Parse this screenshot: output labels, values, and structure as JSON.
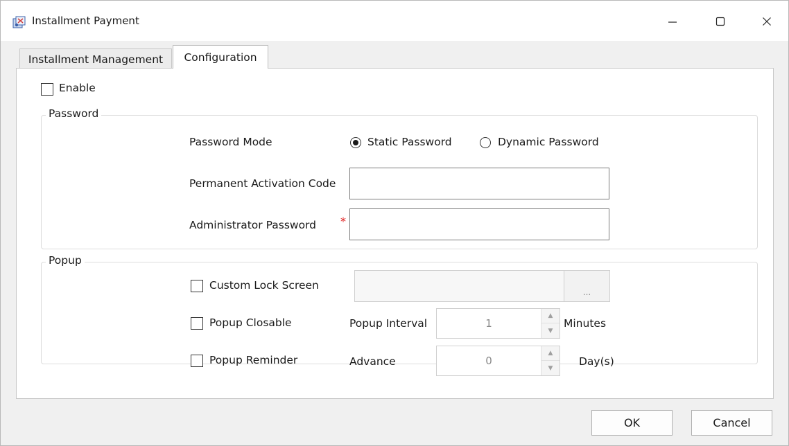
{
  "window": {
    "title": "Installment Payment",
    "icon": "app-icon",
    "controls": [
      "minimize-icon",
      "maximize-icon",
      "close-icon"
    ]
  },
  "tabs": [
    {
      "label": "Installment Management",
      "active": false
    },
    {
      "label": "Configuration",
      "active": true
    }
  ],
  "enable": {
    "label": "Enable",
    "checked": false
  },
  "password": {
    "legend": "Password",
    "mode_label": "Password Mode",
    "modes": [
      {
        "label": "Static Password",
        "selected": true
      },
      {
        "label": "Dynamic Password",
        "selected": false
      }
    ],
    "activation_label": "Permanent Activation Code",
    "activation_value": "",
    "admin_label": "Administrator Password",
    "admin_required_mark": "*",
    "admin_value": ""
  },
  "popup": {
    "legend": "Popup",
    "custom_lock_screen_label": "Custom Lock Screen",
    "custom_lock_screen_checked": false,
    "custom_lock_screen_path": "",
    "browse_label": "...",
    "closable_label": "Popup Closable",
    "closable_checked": false,
    "interval_label": "Popup Interval",
    "interval_value": "1",
    "interval_unit": "Minutes",
    "reminder_label": "Popup Reminder",
    "reminder_checked": false,
    "advance_label": "Advance",
    "advance_value": "0",
    "advance_unit": "Day(s)"
  },
  "buttons": {
    "ok": "OK",
    "cancel": "Cancel"
  },
  "colors": {
    "required": "#e02020",
    "panel": "#ffffff",
    "window": "#f0f0f0"
  }
}
